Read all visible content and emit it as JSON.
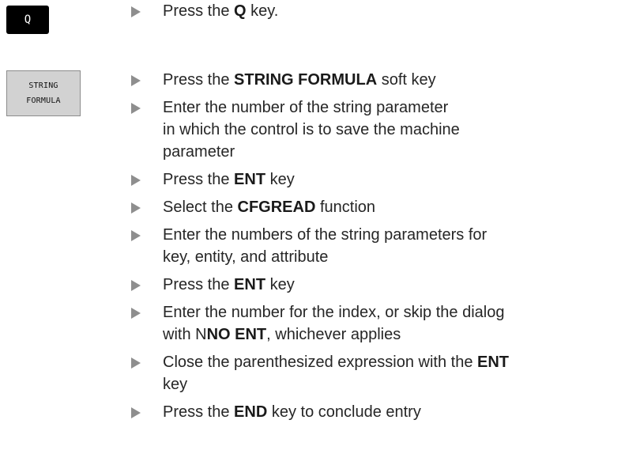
{
  "keys": {
    "q_label": "Q",
    "softkey_line1": "STRING",
    "softkey_line2": "FORMULA"
  },
  "steps": {
    "s0": {
      "a": "Press the ",
      "b": "Q",
      "c": " key."
    },
    "s1": {
      "a": "Press the ",
      "b": "STRING FORMULA",
      "c": " soft key"
    },
    "s2": {
      "l1": "Enter the number of the string parameter",
      "l2": "in which the control is to save the machine",
      "l3": "parameter"
    },
    "s3": {
      "a": "Press the ",
      "b": "ENT",
      "c": " key"
    },
    "s4": {
      "a": "Select the ",
      "b": "CFGREAD",
      "c": " function"
    },
    "s5": {
      "l1": "Enter the numbers of the string parameters for",
      "l2": "key, entity, and attribute"
    },
    "s6": {
      "a": "Press the ",
      "b": "ENT",
      "c": " key"
    },
    "s7": {
      "l1": "Enter the number for the index, or skip the dialog",
      "l2a": "with N",
      "l2b": "NO ENT",
      "l2c": ", whichever applies"
    },
    "s8": {
      "l1a": "Close the parenthesized expression with the ",
      "l1b": "ENT",
      "l2": "key"
    },
    "s9": {
      "a": "Press the ",
      "b": "END",
      "c": " key to conclude entry"
    }
  }
}
